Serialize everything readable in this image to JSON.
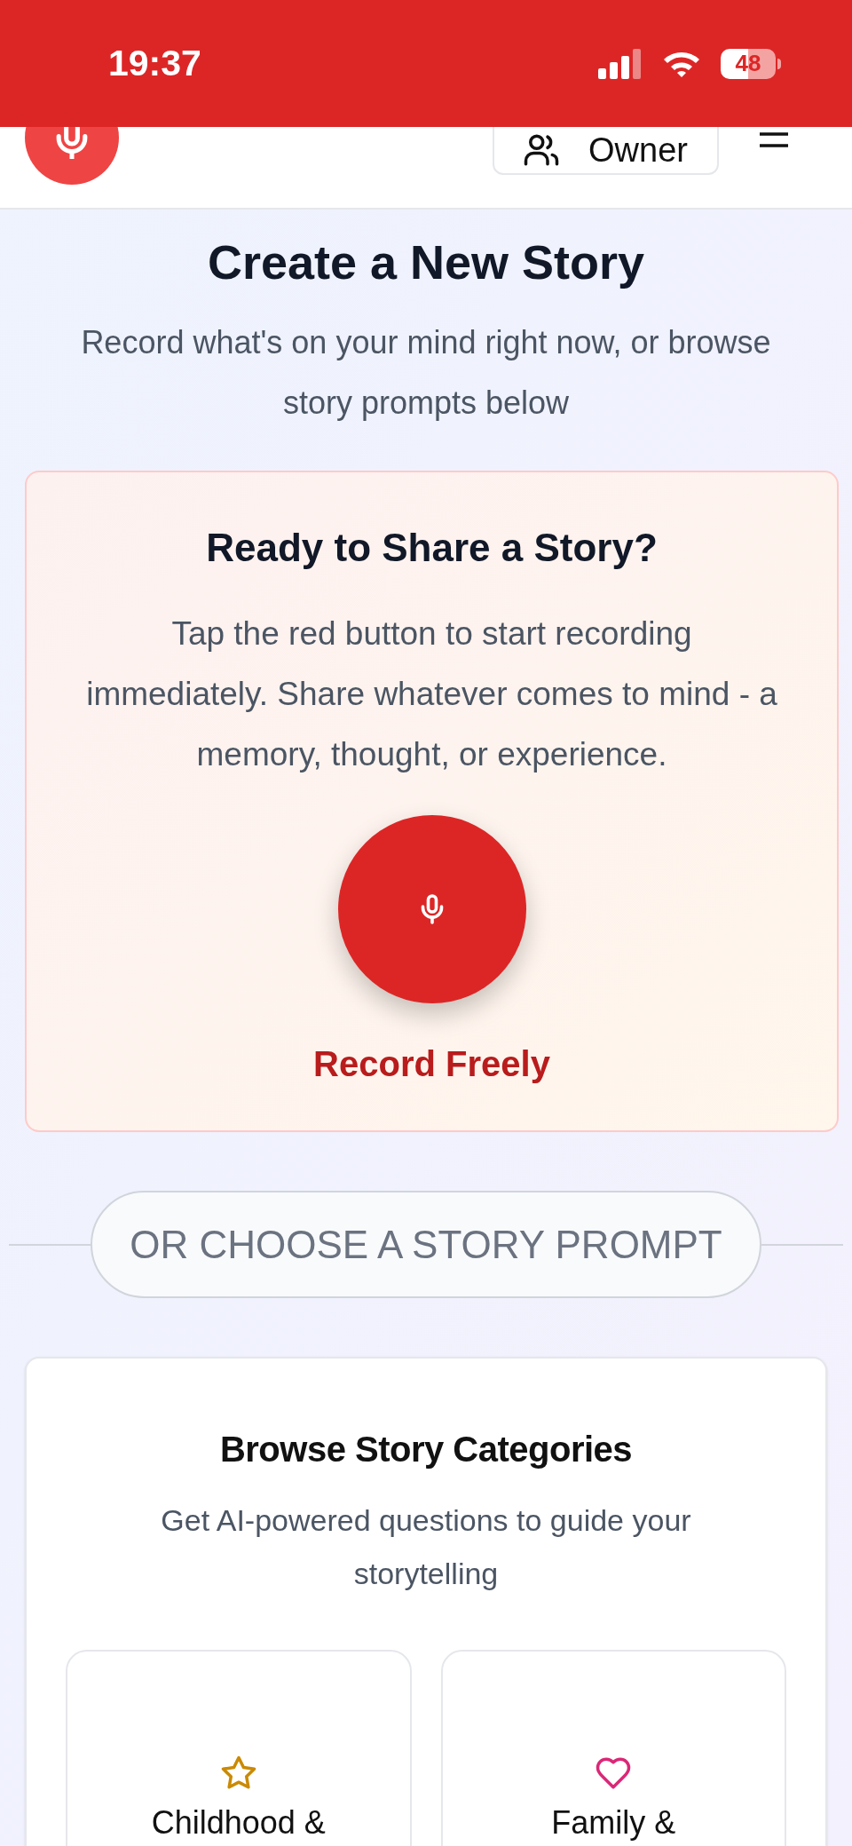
{
  "status_bar": {
    "time": "19:37",
    "battery": "48"
  },
  "header": {
    "account_button": "Owner"
  },
  "page": {
    "title": "Create a New Story",
    "subtitle": "Record what's on your mind right now, or browse story prompts below"
  },
  "record_card": {
    "title": "Ready to Share a Story?",
    "text": "Tap the red button to start recording immediately. Share whatever comes to mind - a memory, thought, or experience.",
    "button_label": "Record Freely"
  },
  "divider": {
    "label": "OR CHOOSE A STORY PROMPT"
  },
  "categories": {
    "title": "Browse Story Categories",
    "subtitle": "Get AI-powered questions to guide your storytelling",
    "items": [
      {
        "kind": "star",
        "label": "Childhood &",
        "color": "#ca8a04"
      },
      {
        "kind": "heart",
        "label": "Family &",
        "color": "#db2777"
      }
    ]
  }
}
